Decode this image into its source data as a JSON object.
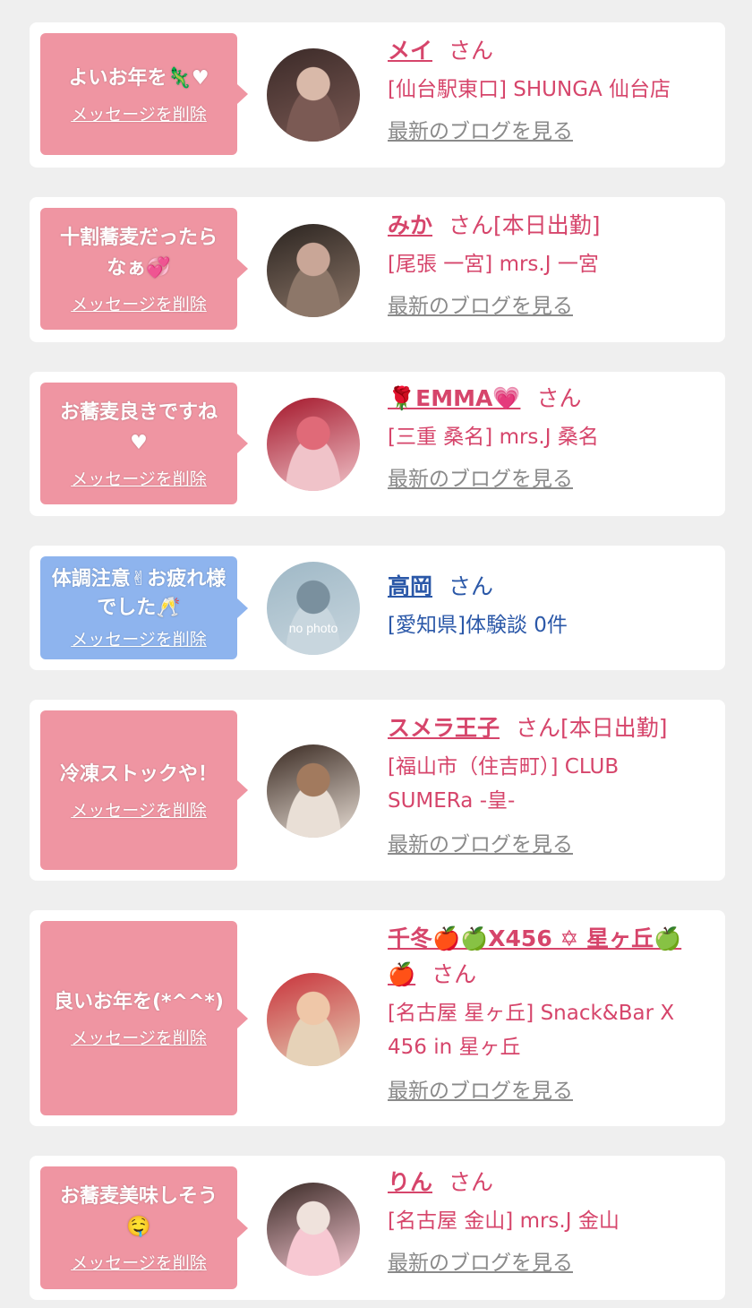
{
  "cards": [
    {
      "message": "よいお年を🦎♥",
      "delete_label": "メッセージを削除",
      "name": "メイ",
      "suffix": "さん",
      "shop": "[仙台駅東口] SHUNGA 仙台店",
      "blog_link": "最新のブログを見る",
      "theme": "pink",
      "avatar_colors": [
        "#3b2a28",
        "#d9b9a9",
        "#7b5a54"
      ]
    },
    {
      "message": "十割蕎麦だったらなぁ💞",
      "delete_label": "メッセージを削除",
      "name": "みか",
      "suffix": "さん[本日出勤]",
      "shop": "[尾張 一宮] mrs.J 一宮",
      "blog_link": "最新のブログを見る",
      "theme": "pink",
      "avatar_colors": [
        "#2b2420",
        "#c9a697",
        "#8d7769"
      ]
    },
    {
      "message": "お蕎麦良きですね♥",
      "delete_label": "メッセージを削除",
      "name": "🌹EMMA💗",
      "suffix": "さん",
      "shop": "[三重 桑名] mrs.J 桑名",
      "blog_link": "最新のブログを見る",
      "theme": "pink",
      "avatar_colors": [
        "#a4162a",
        "#e06a78",
        "#f0c3c9"
      ]
    },
    {
      "message": "体調注意✌お疲れ様でした🥂",
      "delete_label": "メッセージを削除",
      "name": "高岡",
      "suffix": "さん",
      "shop": "[愛知県]体験談 0件",
      "blog_link": "",
      "theme": "blue",
      "no_photo_text": "no photo",
      "avatar_colors": [
        "#9fb8c6",
        "#7a909e",
        "#c8d6de"
      ]
    },
    {
      "message": "冷凍ストックや！",
      "delete_label": "メッセージを削除",
      "name": "スメラ王子",
      "suffix": "さん[本日出勤]",
      "shop": "[福山市（住吉町）] CLUB SUMERa -皇-",
      "blog_link": "最新のブログを見る",
      "theme": "pink",
      "avatar_colors": [
        "#3a2a22",
        "#a27a5e",
        "#e9dfd6"
      ]
    },
    {
      "message": "良いお年を(*^^*)",
      "delete_label": "メッセージを削除",
      "name": "千冬🍎🍏X456 ✡ 星ヶ丘🍏🍎",
      "suffix": "さん",
      "shop": "[名古屋 星ヶ丘] Snack&Bar X 456 in 星ヶ丘",
      "blog_link": "最新のブログを見る",
      "theme": "pink",
      "avatar_colors": [
        "#c8323a",
        "#efc7a8",
        "#e6d2b8"
      ]
    },
    {
      "message": "お蕎麦美味しそう🤤",
      "delete_label": "メッセージを削除",
      "name": "りん",
      "suffix": "さん",
      "shop": "[名古屋 金山] mrs.J 金山",
      "blog_link": "最新のブログを見る",
      "theme": "pink",
      "avatar_colors": [
        "#3a2a26",
        "#efe2dc",
        "#f7c8d2"
      ]
    }
  ]
}
